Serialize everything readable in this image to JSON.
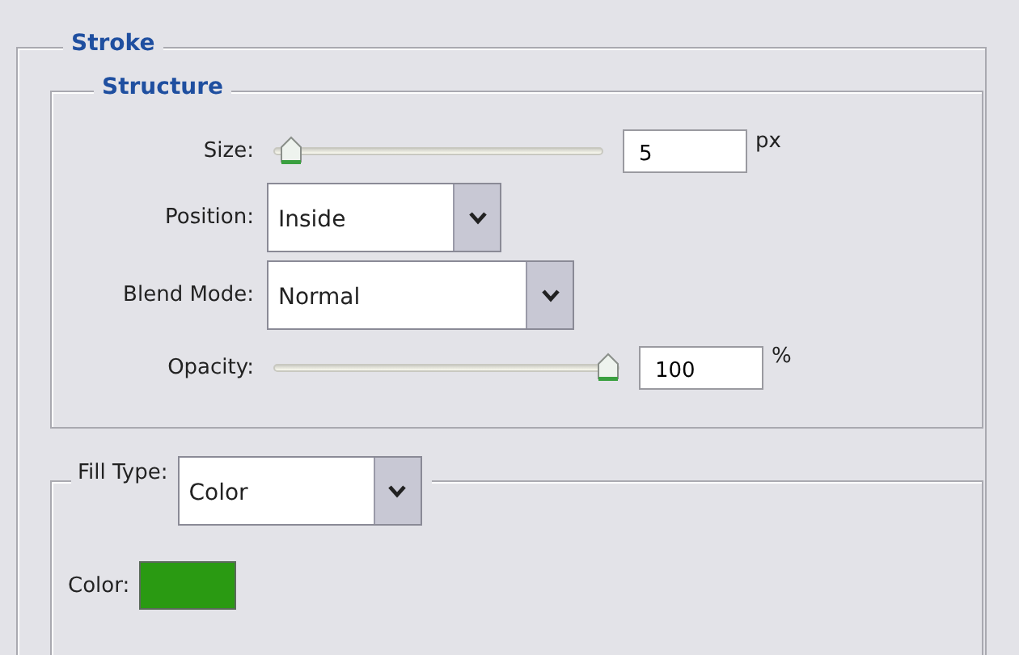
{
  "stroke": {
    "title": "Stroke",
    "structure": {
      "title": "Structure",
      "size": {
        "label": "Size:",
        "level": 0.02,
        "value": "5",
        "unit": "px"
      },
      "position": {
        "label": "Position:",
        "value": "Inside"
      },
      "blend_mode": {
        "label": "Blend Mode:",
        "value": "Normal"
      },
      "opacity": {
        "label": "Opacity:",
        "level": 1.0,
        "value": "100",
        "unit": "%"
      }
    },
    "fill": {
      "label": "Fill Type:",
      "value": "Color",
      "color_label": "Color:",
      "color": "#2a9a12"
    }
  }
}
